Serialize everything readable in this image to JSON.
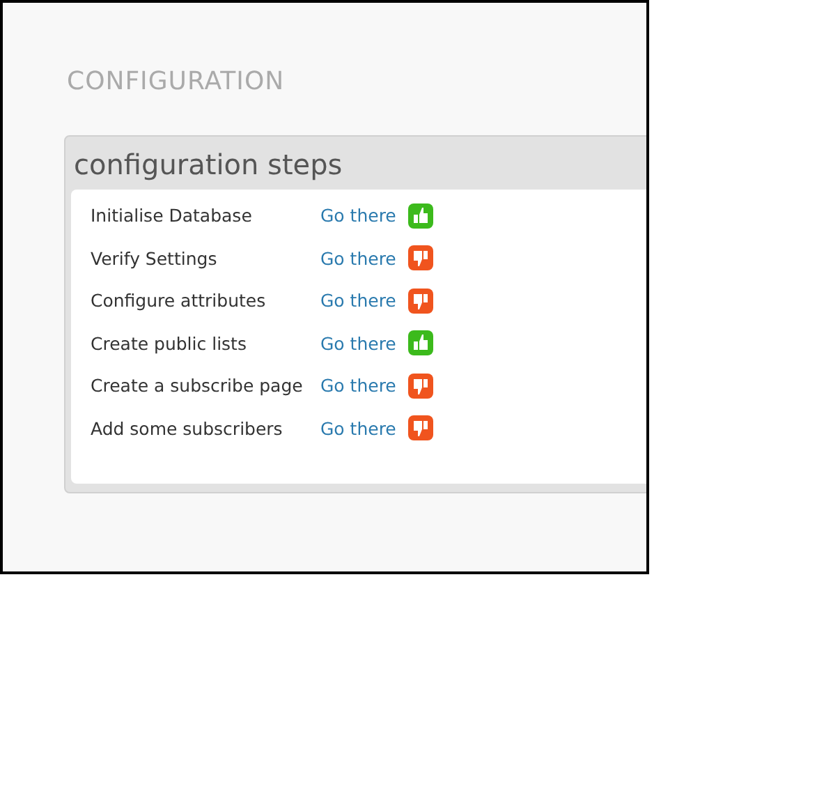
{
  "page_title": "CONFIGURATION",
  "panel": {
    "title": "configuration steps",
    "steps": [
      {
        "label": "Initialise Database",
        "link": "Go there",
        "done": true
      },
      {
        "label": "Verify Settings",
        "link": "Go there",
        "done": false
      },
      {
        "label": "Configure attributes",
        "link": "Go there",
        "done": false
      },
      {
        "label": "Create public lists",
        "link": "Go there",
        "done": true
      },
      {
        "label": "Create a subscribe page",
        "link": "Go there",
        "done": false
      },
      {
        "label": "Add some subscribers",
        "link": "Go there",
        "done": false
      }
    ]
  }
}
